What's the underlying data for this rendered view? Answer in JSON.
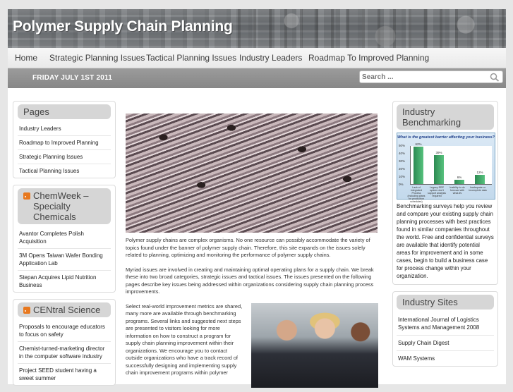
{
  "site": {
    "title": "Polymer Supply Chain Planning"
  },
  "nav": {
    "items": [
      "Home",
      "Strategic Planning Issues",
      "Tactical Planning Issues",
      "Industry Leaders",
      "Roadmap To Improved Planning"
    ]
  },
  "datebar": {
    "date": "FRIDAY JULY 1ST 2011",
    "search_placeholder": "Search ..."
  },
  "pages_widget": {
    "title": "Pages",
    "items": [
      "Industry Leaders",
      "Roadmap to Improved Planning",
      "Strategic Planning Issues",
      "Tactical Planning Issues"
    ]
  },
  "chemweek": {
    "title": "ChemWeek – Specialty Chemicals",
    "items": [
      "Avantor Completes Polish Acquisition",
      "3M Opens Taiwan Wafer Bonding Application Lab",
      "Stepan Acquires Lipid Nutrition Business"
    ]
  },
  "central_science": {
    "title": "CENtral Science",
    "items": [
      "Proposals to encourage educators to focus on safety",
      "Chemist-turned-marketing director in the computer software industry",
      "Project SEED student having a sweet summer"
    ]
  },
  "main": {
    "para1": "Polymer supply chains are complex organisms.  No one resource can possibly accommodate the variety of topics found under the banner of polymer supply chain. Therefore, this site expands on the issues solely related to planning, optimizing and monitoring the performance of polymer supply chains.",
    "para2": "Myriad issues are involved in creating and maintaining optimal operating plans for a supply chain.  We break these into two broad categories, strategic issues and tactical issues.  The issues presented on the following pages describe key issues being addressed within organizations considering supply chain planning process improvements.",
    "para3": "Select real-world improvement metrics are shared, many more are available through benchmarking programs. Several links and suggested next steps are presented to visitors looking for more information on how to construct a program for supply chain planning improvement within their organizations. We encourage you to contact outside organizations who have a track record of successfully designing and implementing supply chain improvement programs within polymer"
  },
  "benchmarking": {
    "title": "Industry Benchmarking",
    "text": "Benchmarking surveys help you review and compare your existing supply chain planning processes with best practices found in similar companies throughout the world. Free and confidential surveys are available that identify potential areas for improvement and in some cases, begin to build a business case for process change within your organization."
  },
  "chart_data": {
    "type": "bar",
    "title": "What is the greatest barrier affecting your business?",
    "categories": [
      "Lack of integrated Process (including plans for production schedules)",
      "Legacy ERP system don't support analysis required",
      "Inability to do forecast with what-ifs",
      "Inadequate or incomplete data"
    ],
    "values": [
      0.62,
      0.39,
      0.06,
      0.12
    ],
    "data_labels": [
      "62%",
      "39%",
      "6%",
      "12%"
    ],
    "yticks": [
      "50%",
      "40%",
      "30%",
      "20%",
      "10%",
      "0%"
    ],
    "ylim": [
      0,
      0.5
    ],
    "colors": {
      "bar": "#3aa463"
    }
  },
  "industry_sites": {
    "title": "Industry Sites",
    "items": [
      "International Journal of Logistics Systems and Management 2008",
      "Supply Chain Digest",
      "WAM Systems"
    ]
  },
  "colors": {
    "header": "#7a7e82",
    "nav_bg": "#efefef",
    "datebar": "#8f8f8f",
    "widget_title": "#d6d6d6",
    "rss": "#e8781e"
  },
  "icons": {
    "search": "search-icon",
    "rss": "rss-icon"
  }
}
